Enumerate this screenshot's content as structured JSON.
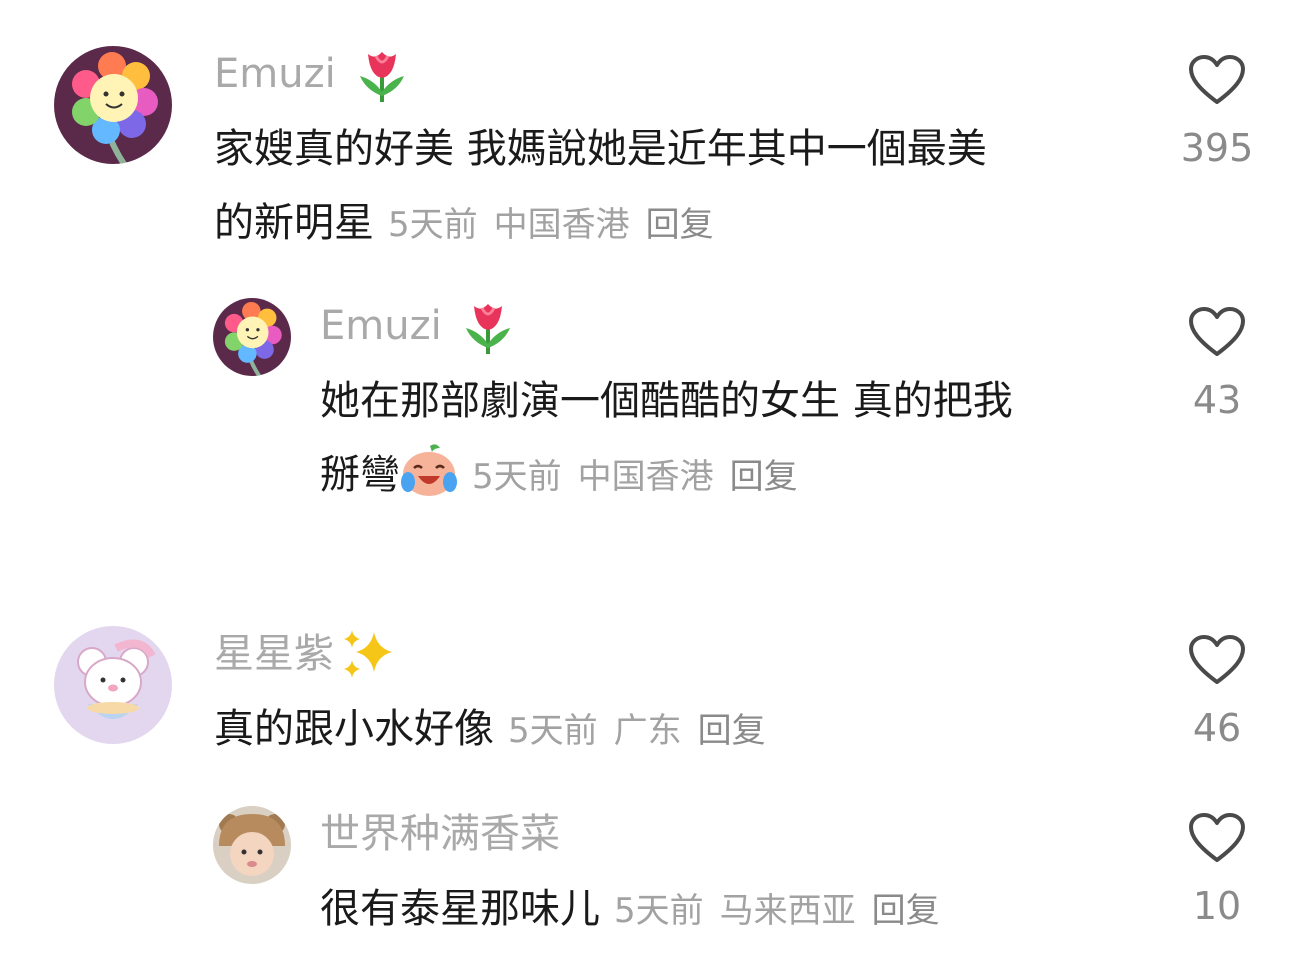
{
  "comments": [
    {
      "username": "Emuzi",
      "username_emoji": "tulip",
      "text_line1": "家嫂真的好美 我媽說她是近年其中一個最美",
      "text_line2": "的新明星",
      "time": "5天前",
      "location": "中国香港",
      "reply_label": "回复",
      "likes": "395"
    },
    {
      "username": "Emuzi",
      "username_emoji": "tulip",
      "text_line1": "她在那部劇演一個酷酷的女生 真的把我",
      "text_line2": "掰彎",
      "inline_emoji": "crying-laughing-face",
      "time": "5天前",
      "location": "中国香港",
      "reply_label": "回复",
      "likes": "43"
    },
    {
      "username": "星星紫",
      "username_emoji": "sparkles",
      "text_line1": "真的跟小水好像",
      "time": "5天前",
      "location": "广东",
      "reply_label": "回复",
      "likes": "46"
    },
    {
      "username": "世界种满香菜",
      "text_line1": "很有泰星那味儿",
      "time": "5天前",
      "location": "马来西亚",
      "reply_label": "回复",
      "likes": "10"
    }
  ]
}
